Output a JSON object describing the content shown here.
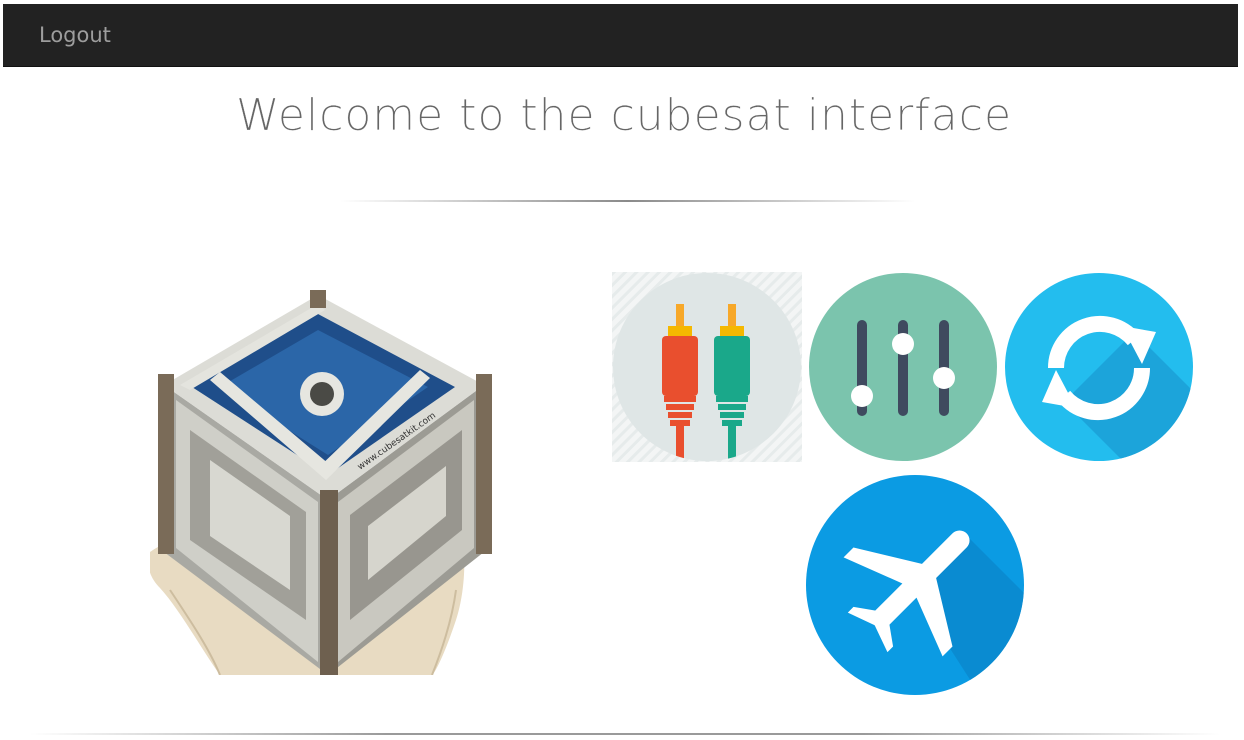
{
  "navbar": {
    "logout_label": "Logout"
  },
  "main": {
    "title": "Welcome to the cubesat interface"
  },
  "tiles": [
    {
      "icon": "rca-cable-icon",
      "color": "#dfe6e6"
    },
    {
      "icon": "sliders-icon",
      "color": "#7bc4ad"
    },
    {
      "icon": "refresh-icon",
      "color": "#23bdee"
    },
    {
      "icon": "airplane-icon",
      "color": "#0b9be3"
    }
  ]
}
